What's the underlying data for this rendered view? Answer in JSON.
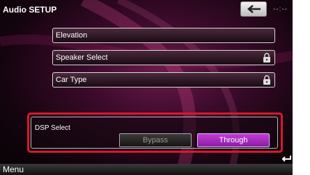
{
  "header": {
    "title": "Audio SETUP",
    "clock": "--:--"
  },
  "menu_items": [
    {
      "label": "Elevation",
      "locked": false
    },
    {
      "label": "Speaker Select",
      "locked": true
    },
    {
      "label": "Car Type",
      "locked": true
    }
  ],
  "dsp": {
    "label": "DSP Select",
    "options": [
      "Bypass",
      "Through"
    ],
    "selected": "Through"
  },
  "footer": {
    "menu_label": "Menu"
  },
  "colors": {
    "highlight_border": "#d8192a",
    "selected_option": "#b22ccc"
  },
  "icons": {
    "back": "back-arrow-icon",
    "lock": "lock-icon",
    "return": "return-arrow-icon"
  }
}
